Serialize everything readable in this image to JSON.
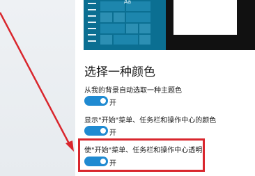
{
  "preview": {
    "tile_label": "Aa",
    "accent_color": "#0b6f92"
  },
  "colors": {
    "heading": "选择一种颜色",
    "options": [
      {
        "label": "从我的背景自动选取一种主题色",
        "toggle_state": "开",
        "on": true
      },
      {
        "label": "显示\"开始\"菜单、任务栏和操作中心的颜色",
        "toggle_state": "开",
        "on": true
      },
      {
        "label": "使\"开始\"菜单、任务栏和操作中心透明",
        "toggle_state": "开",
        "on": true
      }
    ]
  },
  "annotation": {
    "color": "#d9262d"
  }
}
